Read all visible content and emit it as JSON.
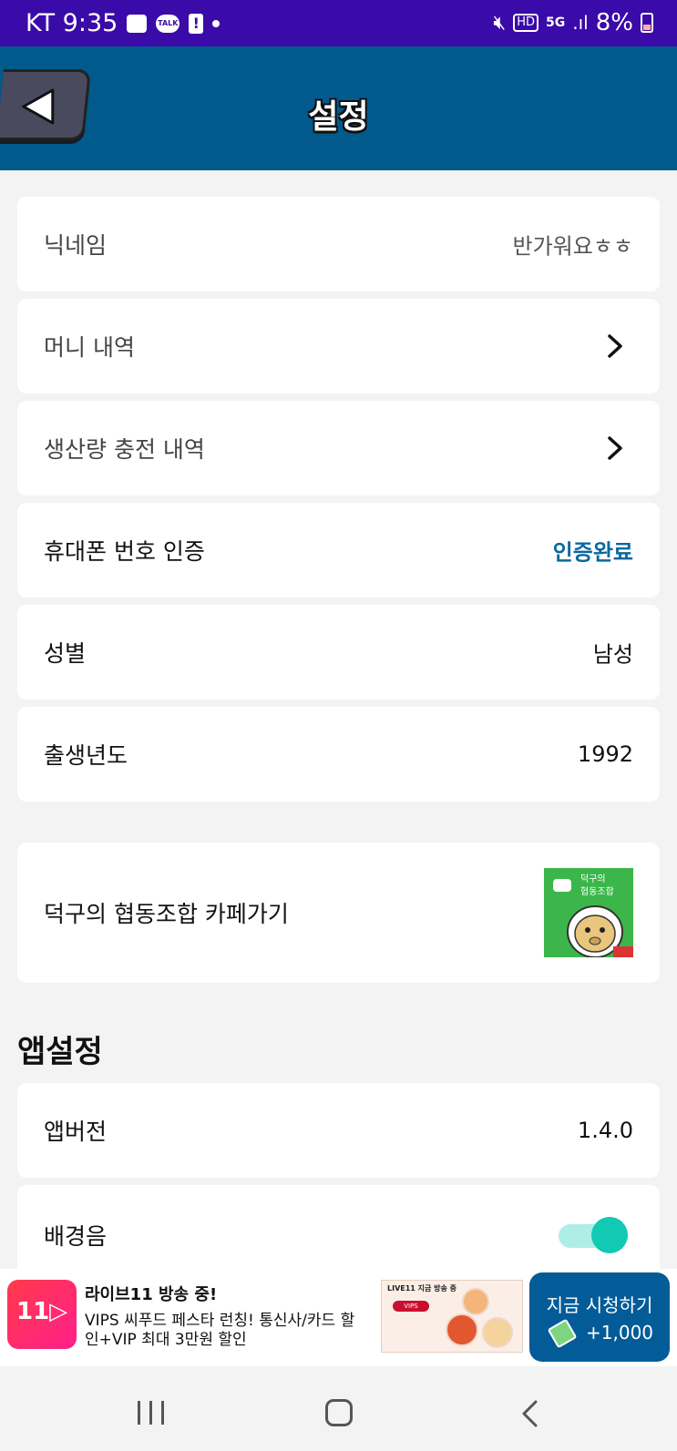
{
  "status_bar": {
    "carrier_time": "KT 9:35",
    "talk_label": "TALK",
    "alert_label": "!",
    "hd_label": "HD",
    "network_label": "5G",
    "battery": "8%"
  },
  "header": {
    "title": "설정"
  },
  "rows": {
    "nickname": {
      "label": "닉네임",
      "value": "반가워요ㅎㅎ"
    },
    "money_history": {
      "label": "머니 내역"
    },
    "production_history": {
      "label": "생산량 충전 내역"
    },
    "phone_verify": {
      "label": "휴대폰 번호 인증",
      "value": "인증완료"
    },
    "gender": {
      "label": "성별",
      "value": "남성"
    },
    "birth_year": {
      "label": "출생년도",
      "value": "1992"
    },
    "cafe": {
      "label": "덕구의 협동조합 카페가기",
      "image_text_line1": "덕구의",
      "image_text_line2": "협동조합"
    }
  },
  "app_settings": {
    "section_title": "앱설정",
    "version": {
      "label": "앱버전",
      "value": "1.4.0"
    },
    "bgm": {
      "label": "배경음",
      "enabled": true
    }
  },
  "ad": {
    "logo_text": "11▷",
    "title": "라이브11 방송 중!",
    "description": "VIPS 씨푸드 페스타 런칭! 통신사/카드 할인+VIP 최대 3만원 할인",
    "thumb_line": "LIVE11 지금 방송 중",
    "thumb_brand": "VIPS",
    "cta_label": "지금 시청하기",
    "cta_reward": "+1,000"
  },
  "colors": {
    "status_bar": "#3a0ba8",
    "header": "#025a8c",
    "verified": "#0a67a0",
    "toggle_on": "#12c9b4",
    "cta": "#035c98"
  },
  "icons": {
    "back": "triangle-left-icon",
    "chevron": "chevron-right-icon",
    "nav_recent": "recent-apps-icon",
    "nav_home": "home-icon",
    "nav_back": "back-icon"
  }
}
